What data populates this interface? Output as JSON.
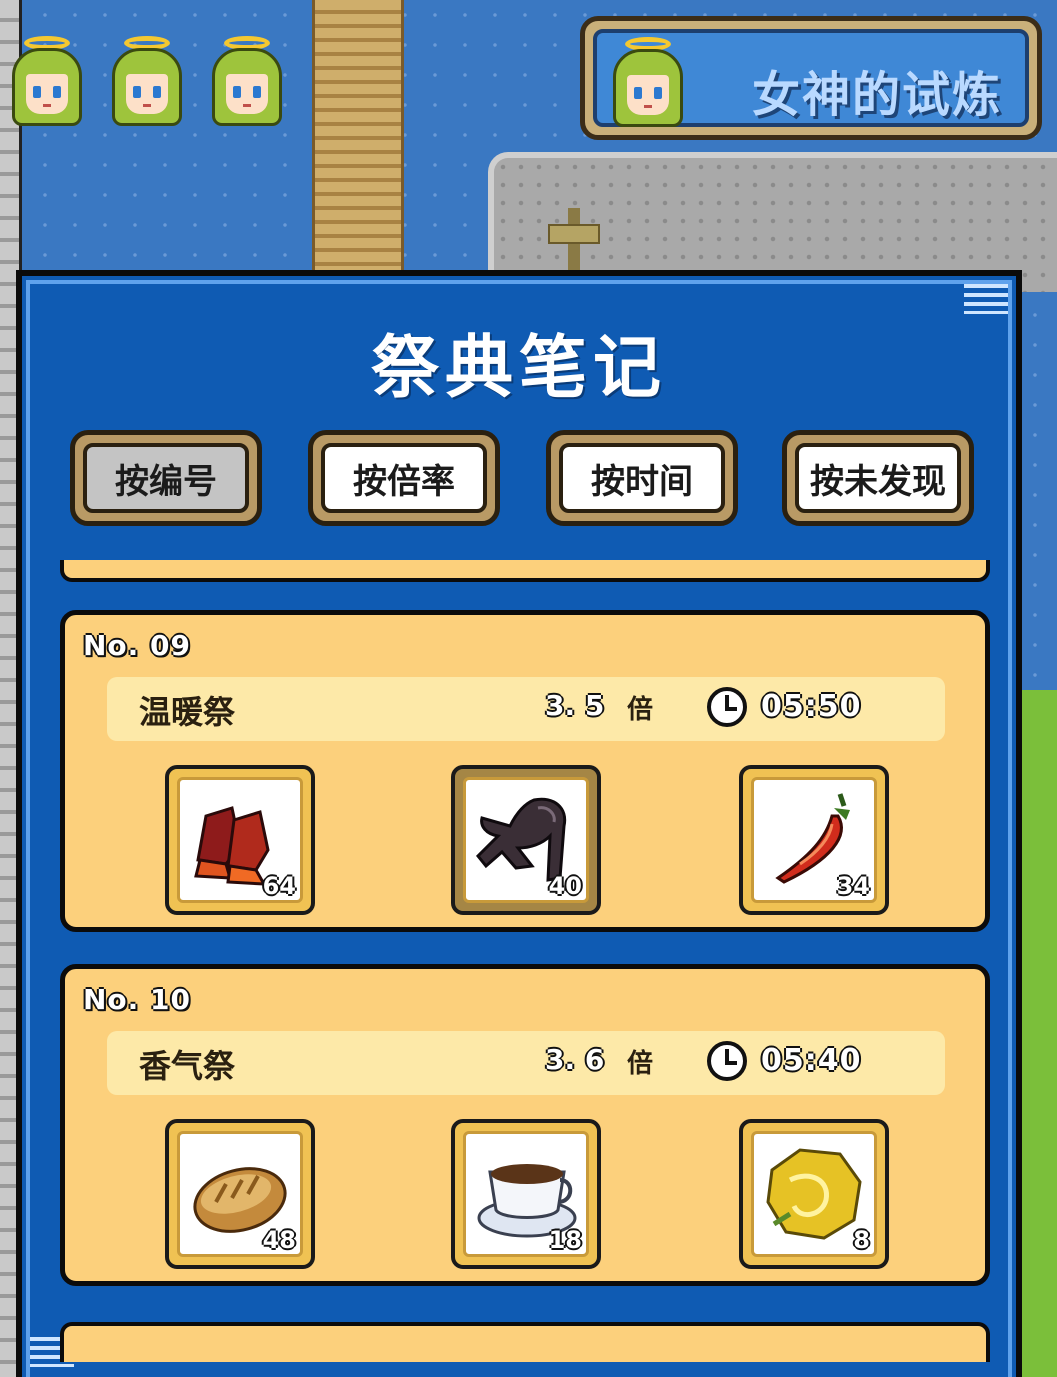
{
  "hud": {
    "lives": 3,
    "trial_button_label": "女神的试炼"
  },
  "panel": {
    "title": "祭典笔记",
    "sort_buttons": [
      {
        "label": "按编号",
        "active": true
      },
      {
        "label": "按倍率",
        "active": false
      },
      {
        "label": "按时间",
        "active": false
      },
      {
        "label": "按未发现",
        "active": false
      }
    ]
  },
  "entries": [
    {
      "no": "No. 09",
      "name": "温暖祭",
      "rate": "3. 5",
      "rate_unit": "倍",
      "time": "05:50",
      "items": [
        {
          "icon": "red-boots-icon",
          "count": "64"
        },
        {
          "icon": "dark-bat-wing-icon",
          "count": "40"
        },
        {
          "icon": "red-chili-pepper-icon",
          "count": "34"
        }
      ]
    },
    {
      "no": "No. 10",
      "name": "香气祭",
      "rate": "3. 6",
      "rate_unit": "倍",
      "time": "05:40",
      "items": [
        {
          "icon": "bread-loaf-icon",
          "count": "48"
        },
        {
          "icon": "coffee-cup-icon",
          "count": "18"
        },
        {
          "icon": "golden-herb-icon",
          "count": "8"
        }
      ]
    }
  ],
  "colors": {
    "panel_blue": "#0f5bb3",
    "entry_cream": "#fcd07c",
    "water_blue": "#3a78c2"
  }
}
